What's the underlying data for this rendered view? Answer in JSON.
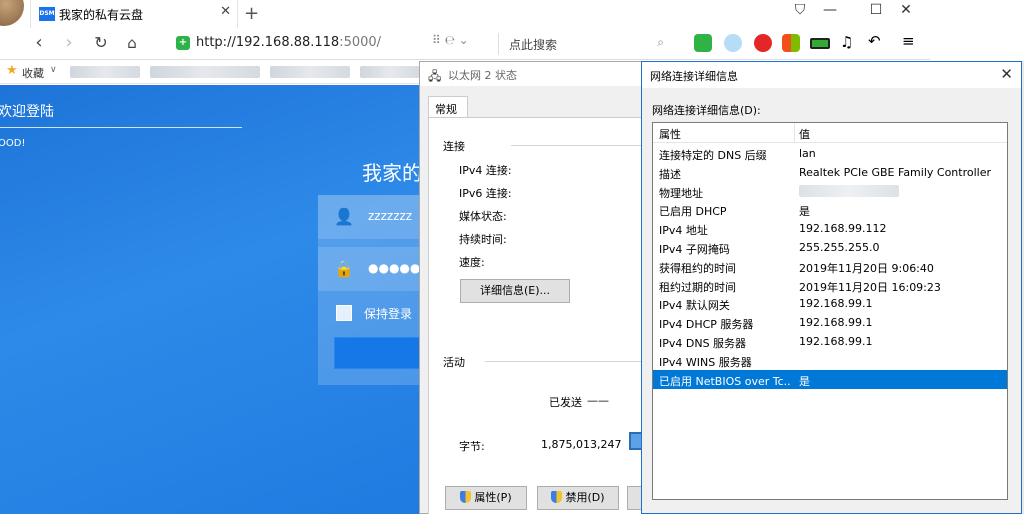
{
  "browser": {
    "tab_title": "我家的私有云盘",
    "tab_favicon_text": "DSM",
    "url_main": "http://192.168.88.118",
    "url_port": ":5000/",
    "search_placeholder": "点此搜索",
    "bookmarks_label": "收藏",
    "icons": {
      "back": "back-arrow-icon",
      "forward": "forward-arrow-icon",
      "refresh": "refresh-icon",
      "home": "home-icon",
      "security": "shield-check-icon",
      "search": "search-icon",
      "star": "star-icon"
    }
  },
  "dsm": {
    "welcome": "欢迎登陆",
    "subtitle": "OOD!",
    "title": "我家的",
    "username": "zzzzzzz",
    "password": "●●●●●●",
    "remember": "保持登录",
    "accent": "#1f7be0"
  },
  "eth_window": {
    "title": "以太网 2 状态",
    "tab": "常规",
    "connection_group": "连接",
    "fields": [
      "IPv4 连接:",
      "IPv6 连接:",
      "媒体状态:",
      "持续时间:",
      "速度:"
    ],
    "details_button": "详细信息(E)...",
    "activity_group": "活动",
    "sent_label": "已发送",
    "sent_dash": "——",
    "bytes_label": "字节:",
    "bytes_value": "1,875,013,247",
    "properties_button": "属性(P)",
    "disable_button": "禁用(D)"
  },
  "details_dialog": {
    "title": "网络连接详细信息",
    "label": "网络连接详细信息(D):",
    "close": "✕",
    "col_property": "属性",
    "col_value": "值",
    "selection_color": "#0078d7",
    "rows": [
      {
        "p": "连接特定的 DNS 后缀",
        "v": "lan"
      },
      {
        "p": "描述",
        "v": "Realtek PCIe GBE Family Controller"
      },
      {
        "p": "物理地址",
        "v": ""
      },
      {
        "p": "已启用 DHCP",
        "v": "是"
      },
      {
        "p": "IPv4 地址",
        "v": "192.168.99.112"
      },
      {
        "p": "IPv4 子网掩码",
        "v": "255.255.255.0"
      },
      {
        "p": "获得租约的时间",
        "v": "2019年11月20日 9:06:40"
      },
      {
        "p": "租约过期的时间",
        "v": "2019年11月20日 16:09:23"
      },
      {
        "p": "IPv4 默认网关",
        "v": "192.168.99.1"
      },
      {
        "p": "IPv4 DHCP 服务器",
        "v": "192.168.99.1"
      },
      {
        "p": "IPv4 DNS 服务器",
        "v": "192.168.99.1"
      },
      {
        "p": "IPv4 WINS 服务器",
        "v": ""
      },
      {
        "p": "已启用 NetBIOS over Tc...",
        "v": "是"
      }
    ]
  }
}
